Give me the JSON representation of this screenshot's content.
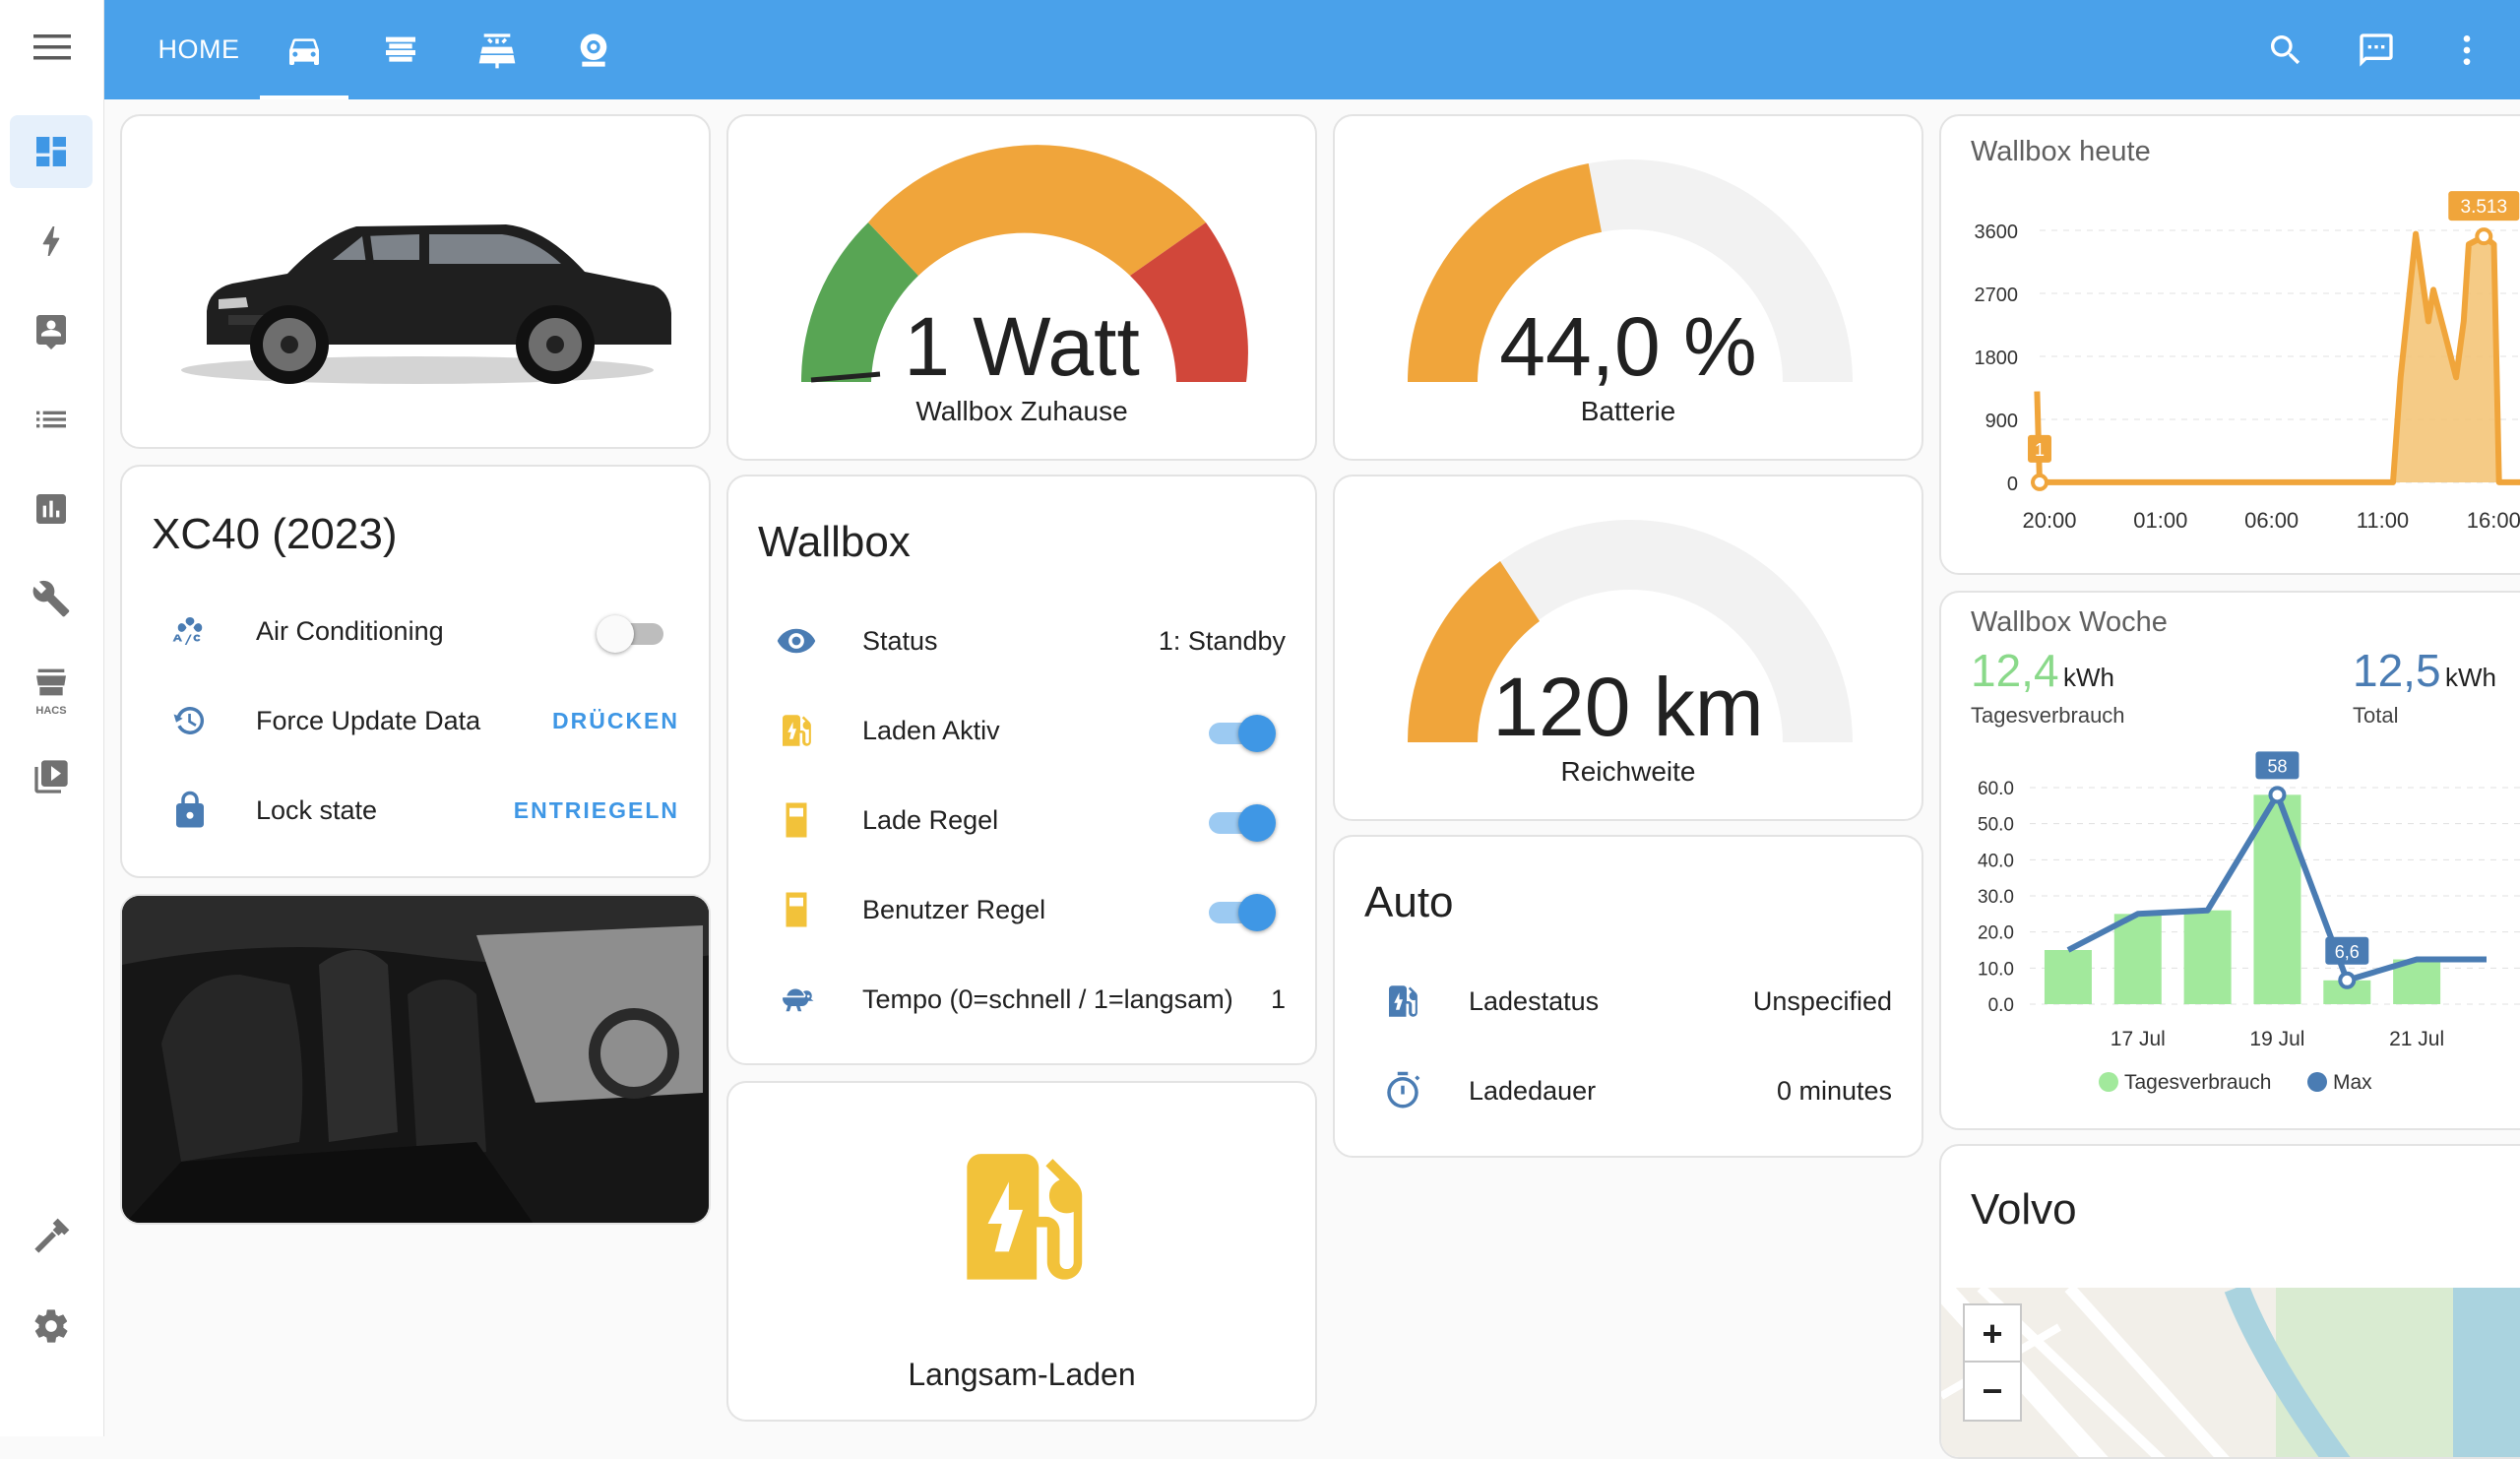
{
  "header": {
    "home_label": "HOME",
    "tabs": [
      "car-icon",
      "wallbox-icon",
      "solar-icon",
      "webcam-icon"
    ],
    "actions": [
      "search-icon",
      "assist-icon",
      "more-icon"
    ]
  },
  "sidebar": {
    "items": [
      "dashboard-icon",
      "energy-icon",
      "people-icon",
      "list-icon",
      "chart-icon",
      "wrench-icon",
      "hacs-icon",
      "media-icon",
      "hammer-icon",
      "gear-icon"
    ],
    "hacs_label": "HACS"
  },
  "car_card": {
    "title": "XC40 (2023)",
    "rows": [
      {
        "label": "Air Conditioning",
        "icon": "ac-icon",
        "state": "off"
      },
      {
        "label": "Force Update Data",
        "icon": "refresh-icon",
        "action": "DRÜCKEN"
      },
      {
        "label": "Lock state",
        "icon": "lock-icon",
        "action": "ENTRIEGELN"
      }
    ]
  },
  "gauges": {
    "wallbox": {
      "value": "1 Watt",
      "label": "Wallbox Zuhause"
    },
    "battery": {
      "value": "44,0 %",
      "label": "Batterie",
      "percent": 44
    },
    "range": {
      "value": "120 km",
      "label": "Reichweite"
    }
  },
  "wallbox_card": {
    "title": "Wallbox",
    "rows": [
      {
        "label": "Status",
        "value": "1: Standby",
        "icon": "eye-icon"
      },
      {
        "label": "Laden Aktiv",
        "icon": "ev-station-icon",
        "state": "on"
      },
      {
        "label": "Lade Regel",
        "icon": "fuel-icon",
        "state": "on"
      },
      {
        "label": "Benutzer Regel",
        "icon": "fuel-icon",
        "state": "on"
      },
      {
        "label": "Tempo (0=schnell / 1=langsam)",
        "value": "1",
        "icon": "turtle-icon"
      }
    ]
  },
  "langsam": {
    "label": "Langsam-Laden"
  },
  "auto_card": {
    "title": "Auto",
    "rows": [
      {
        "label": "Ladestatus",
        "value": "Unspecified",
        "icon": "ev-station-icon"
      },
      {
        "label": "Ladedauer",
        "value": "0 minutes",
        "icon": "timer-icon"
      }
    ]
  },
  "heute": {
    "title": "Wallbox heute",
    "peak_label": "3.513",
    "start_label": "1"
  },
  "woche": {
    "title": "Wallbox Woche",
    "stat1": {
      "value": "12,4",
      "unit": "kWh",
      "label": "Tagesverbrauch"
    },
    "stat2": {
      "value": "12,5",
      "unit": "kWh",
      "label": "Total"
    },
    "peak_label": "58",
    "low_label": "6,6",
    "legend": [
      "Tagesverbrauch",
      "Max"
    ]
  },
  "volvo": {
    "title": "Volvo",
    "zoom_in": "+",
    "zoom_out": "−"
  },
  "colors": {
    "accent": "#3f97e5",
    "header": "#4aa1ea",
    "orange": "#f0a53b",
    "green": "#58a554",
    "red": "#d1473a",
    "gauge_bg": "#f2f2f2",
    "bar_green": "#a2e99c",
    "line_blue": "#4a7cb3"
  },
  "chart_data": [
    {
      "type": "area",
      "title": "Wallbox heute",
      "x_ticks": [
        "20:00",
        "01:00",
        "06:00",
        "11:00",
        "16:00"
      ],
      "y_ticks": [
        "0",
        "900",
        "1800",
        "2700",
        "3600"
      ],
      "ylim": [
        0,
        3600
      ],
      "points": [
        [
          -0.1,
          1300
        ],
        [
          0,
          1
        ],
        [
          5,
          1
        ],
        [
          10,
          1
        ],
        [
          14,
          1
        ],
        [
          14.3,
          1500
        ],
        [
          14.9,
          3550
        ],
        [
          15.4,
          2300
        ],
        [
          15.6,
          2750
        ],
        [
          16,
          2200
        ],
        [
          16.5,
          1500
        ],
        [
          16.8,
          2300
        ],
        [
          17,
          3400
        ],
        [
          17.6,
          3513
        ],
        [
          18,
          3400
        ],
        [
          18.2,
          1
        ],
        [
          19.5,
          1
        ]
      ],
      "series_name": "Wallbox"
    },
    {
      "type": "bar",
      "title": "Wallbox Woche",
      "categories": [
        "16 Jul",
        "17 Jul",
        "18 Jul",
        "19 Jul",
        "20 Jul",
        "21 Jul",
        "22 Jul"
      ],
      "x_ticks": [
        "17 Jul",
        "19 Jul",
        "21 Jul"
      ],
      "y_ticks": [
        "0.0",
        "10.0",
        "20.0",
        "30.0",
        "40.0",
        "50.0",
        "60.0"
      ],
      "ylim": [
        0,
        60
      ],
      "series": [
        {
          "name": "Tagesverbrauch",
          "values": [
            15,
            25,
            26,
            58,
            6.6,
            12.4,
            0
          ]
        },
        {
          "name": "Max",
          "values": [
            15,
            25,
            26,
            58,
            6.6,
            12.4,
            12.4
          ]
        }
      ]
    }
  ]
}
